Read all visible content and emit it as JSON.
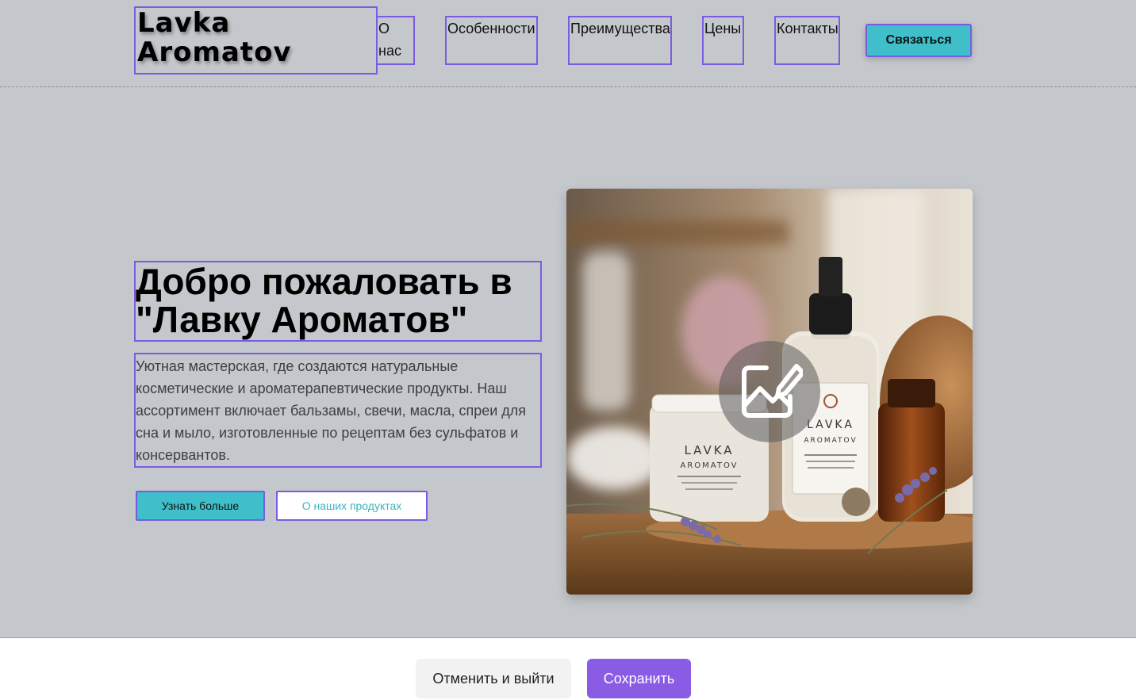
{
  "header": {
    "logo_line1": "Lavka",
    "logo_line2": "Aromatov",
    "nav": [
      {
        "label": "О нас"
      },
      {
        "label": "Особенности"
      },
      {
        "label": "Преимущества"
      },
      {
        "label": "Цены"
      },
      {
        "label": "Контакты"
      }
    ],
    "contact_button": "Связаться"
  },
  "hero": {
    "title": "Добро пожаловать в \"Лавку Ароматов\"",
    "description": "Уютная мастерская, где создаются натуральные косметические и ароматерапевтические продукты. Наш ассортимент включает бальзамы, свечи, масла, спреи для сна и мыло, изготовленные по рецептам без сульфатов и консервантов.",
    "primary_button": "Узнать больше",
    "secondary_button": "О наших продуктах",
    "image": {
      "jar_label_line1": "LAVKA",
      "jar_label_line2": "AROMATOV",
      "bottle_label_line1": "LAVKA",
      "bottle_label_line2": "AROMATOV",
      "edit_icon": "image-edit-icon"
    }
  },
  "editor_bar": {
    "cancel_label": "Отменить и выйти",
    "save_label": "Сохранить"
  },
  "colors": {
    "accent_teal": "#3fbfc9",
    "selection_purple": "#7a5ce0",
    "save_purple": "#8a5ce6",
    "page_background": "#c4c7cb"
  }
}
